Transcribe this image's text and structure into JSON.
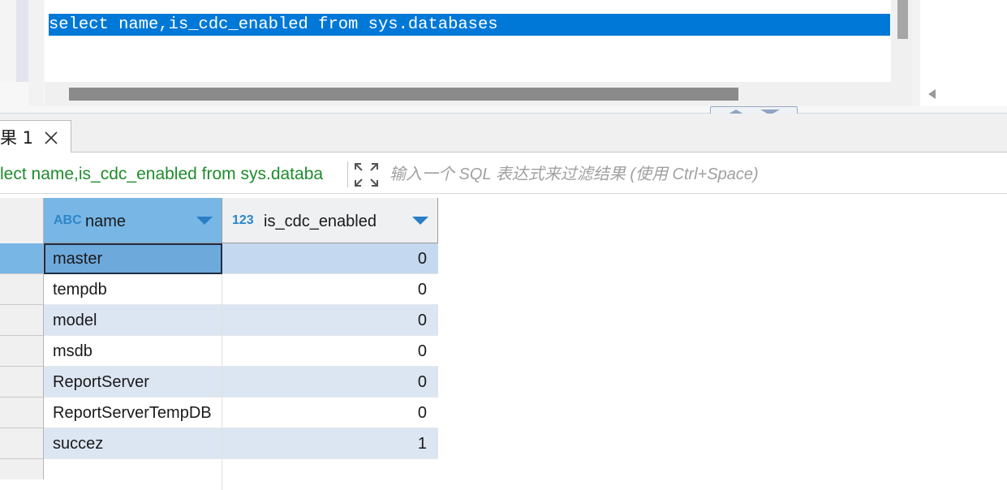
{
  "editor": {
    "sql": "select name,is_cdc_enabled from sys.databases"
  },
  "results": {
    "tab_label": "果 1",
    "query_text": "lect name,is_cdc_enabled from sys.databa",
    "filter_placeholder": "输入一个 SQL 表达式来过滤结果 (使用 Ctrl+Space)",
    "columns": [
      {
        "type_badge": "ABC",
        "label": "name"
      },
      {
        "type_badge": "123",
        "label": "is_cdc_enabled"
      }
    ],
    "rows": [
      {
        "name": "master",
        "is_cdc_enabled": "0"
      },
      {
        "name": "tempdb",
        "is_cdc_enabled": "0"
      },
      {
        "name": "model",
        "is_cdc_enabled": "0"
      },
      {
        "name": "msdb",
        "is_cdc_enabled": "0"
      },
      {
        "name": "ReportServer",
        "is_cdc_enabled": "0"
      },
      {
        "name": "ReportServerTempDB",
        "is_cdc_enabled": "0"
      },
      {
        "name": "succez",
        "is_cdc_enabled": "1"
      }
    ],
    "selected_row": 0
  },
  "colors": {
    "selection": "#0078d7",
    "query_text": "#1e8c2c",
    "header_selected": "#78b6e6",
    "row_alt": "#dce6f2",
    "row_selected": "#c4d9ef"
  }
}
